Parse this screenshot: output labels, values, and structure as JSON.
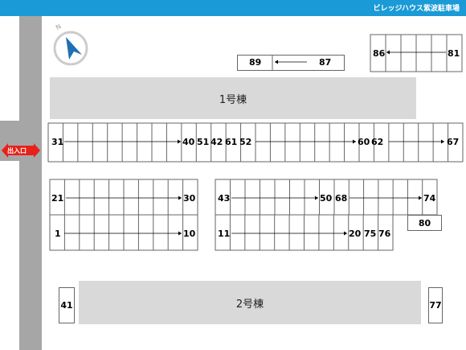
{
  "header": {
    "title": "ビレッジハウス紫波駐車場",
    "color": "#1a9ad6"
  },
  "compass": {
    "label": "N"
  },
  "entrance": {
    "label": "出入口",
    "color": "#e8201a"
  },
  "buildings": {
    "b1": "1号棟",
    "b2": "2号棟"
  },
  "rows": {
    "top_small": {
      "start": "89",
      "end": "87"
    },
    "top_right": {
      "start": "86",
      "end": "81"
    },
    "long_a": {
      "start": "31",
      "end": "40"
    },
    "long_b_labels": [
      "51",
      "42",
      "61"
    ],
    "long_c": {
      "start": "52",
      "end": "60"
    },
    "long_d": {
      "start": "62",
      "end": "67"
    },
    "left_upper": {
      "start": "21",
      "end": "30"
    },
    "left_lower": {
      "start": "1",
      "end": "10"
    },
    "mid_upper": {
      "start": "43",
      "end": "50"
    },
    "right_upper": {
      "start": "68",
      "end": "74"
    },
    "mid_lower": {
      "start": "11",
      "end": "20"
    },
    "mid_lower_extra": [
      "75",
      "76"
    ],
    "single_80": "80",
    "single_41": "41",
    "single_77": "77"
  }
}
